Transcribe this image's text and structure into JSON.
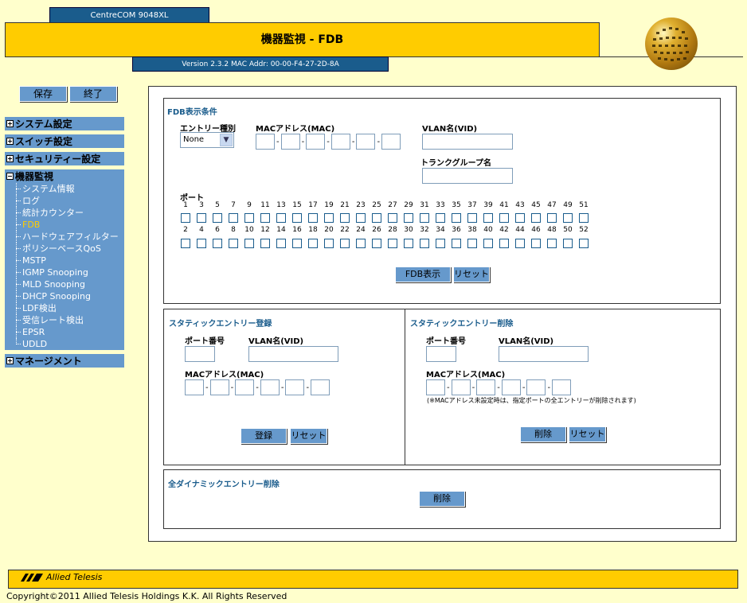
{
  "header": {
    "model": "CentreCOM 9048XL",
    "title": "機器監視 - FDB",
    "version": "Version 2.3.2 MAC Addr: 00-00-F4-27-2D-8A"
  },
  "toolbar": {
    "save_label": "保存",
    "exit_label": "終了"
  },
  "menu": {
    "system": "システム設定",
    "switch": "スイッチ設定",
    "security": "セキュリティー設定",
    "monitor": "機器監視",
    "monitor_items": [
      "システム情報",
      "ログ",
      "統計カウンター",
      "FDB",
      "ハードウェアフィルター",
      "ポリシーベースQoS",
      "MSTP",
      "IGMP Snooping",
      "MLD Snooping",
      "DHCP Snooping",
      "LDF検出",
      "受信レート検出",
      "EPSR",
      "UDLD"
    ],
    "management": "マネージメント"
  },
  "fdb_display": {
    "title": "FDB表示条件",
    "entry_type_label": "エントリー種別",
    "entry_type_value": "None",
    "mac_label": "MACアドレス(MAC)",
    "vlan_label": "VLAN名(VID)",
    "trunk_label": "トランクグループ名",
    "port_label": "ポート",
    "odd_ports": [
      "1",
      "3",
      "5",
      "7",
      "9",
      "11",
      "13",
      "15",
      "17",
      "19",
      "21",
      "23",
      "25",
      "27",
      "29",
      "31",
      "33",
      "35",
      "37",
      "39",
      "41",
      "43",
      "45",
      "47",
      "49",
      "51"
    ],
    "even_ports": [
      "2",
      "4",
      "6",
      "8",
      "10",
      "12",
      "14",
      "16",
      "18",
      "20",
      "22",
      "24",
      "26",
      "28",
      "30",
      "32",
      "34",
      "36",
      "38",
      "40",
      "42",
      "44",
      "46",
      "48",
      "50",
      "52"
    ],
    "show_button": "FDB表示",
    "reset_button": "リセット"
  },
  "static_register": {
    "title": "スタティックエントリー登録",
    "port_label": "ポート番号",
    "vlan_label": "VLAN名(VID)",
    "mac_label": "MACアドレス(MAC)",
    "register_button": "登録",
    "reset_button": "リセット"
  },
  "static_delete": {
    "title": "スタティックエントリー削除",
    "port_label": "ポート番号",
    "vlan_label": "VLAN名(VID)",
    "mac_label": "MACアドレス(MAC)",
    "note": "(※MACアドレス未設定時は、指定ポートの全エントリーが削除されます)",
    "delete_button": "削除",
    "reset_button": "リセット"
  },
  "dynamic_delete": {
    "title": "全ダイナミックエントリー削除",
    "delete_button": "削除"
  },
  "footer": {
    "logo": "Allied Telesis",
    "copyright": "Copyright©2011 Allied Telesis Holdings K.K. All Rights Reserved"
  }
}
